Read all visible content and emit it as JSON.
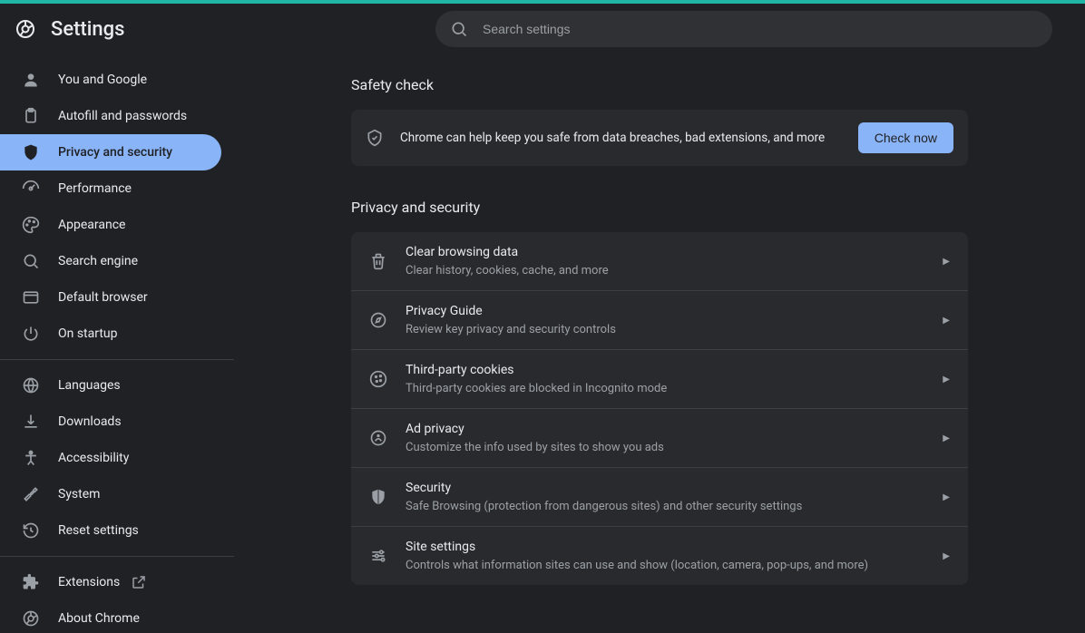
{
  "header": {
    "title": "Settings",
    "search_placeholder": "Search settings"
  },
  "sidebar": {
    "group1": [
      {
        "id": "you-google",
        "label": "You and Google",
        "icon": "person"
      },
      {
        "id": "autofill",
        "label": "Autofill and passwords",
        "icon": "clipboard"
      },
      {
        "id": "privacy",
        "label": "Privacy and security",
        "icon": "shield",
        "active": true
      },
      {
        "id": "performance",
        "label": "Performance",
        "icon": "speed"
      },
      {
        "id": "appearance",
        "label": "Appearance",
        "icon": "palette"
      },
      {
        "id": "search-engine",
        "label": "Search engine",
        "icon": "search"
      },
      {
        "id": "default-browser",
        "label": "Default browser",
        "icon": "browser"
      },
      {
        "id": "startup",
        "label": "On startup",
        "icon": "power"
      }
    ],
    "group2": [
      {
        "id": "languages",
        "label": "Languages",
        "icon": "globe"
      },
      {
        "id": "downloads",
        "label": "Downloads",
        "icon": "download"
      },
      {
        "id": "accessibility",
        "label": "Accessibility",
        "icon": "accessibility"
      },
      {
        "id": "system",
        "label": "System",
        "icon": "wrench"
      },
      {
        "id": "reset",
        "label": "Reset settings",
        "icon": "history"
      }
    ],
    "group3": [
      {
        "id": "extensions",
        "label": "Extensions",
        "icon": "extension",
        "external": true
      },
      {
        "id": "about",
        "label": "About Chrome",
        "icon": "chrome"
      }
    ]
  },
  "safety": {
    "heading": "Safety check",
    "text": "Chrome can help keep you safe from data breaches, bad extensions, and more",
    "button": "Check now"
  },
  "privacy": {
    "heading": "Privacy and security",
    "rows": [
      {
        "icon": "trash",
        "title": "Clear browsing data",
        "sub": "Clear history, cookies, cache, and more"
      },
      {
        "icon": "compass",
        "title": "Privacy Guide",
        "sub": "Review key privacy and security controls"
      },
      {
        "icon": "cookie",
        "title": "Third-party cookies",
        "sub": "Third-party cookies are blocked in Incognito mode"
      },
      {
        "icon": "ad",
        "title": "Ad privacy",
        "sub": "Customize the info used by sites to show you ads"
      },
      {
        "icon": "shield",
        "title": "Security",
        "sub": "Safe Browsing (protection from dangerous sites) and other security settings"
      },
      {
        "icon": "sliders",
        "title": "Site settings",
        "sub": "Controls what information sites can use and show (location, camera, pop-ups, and more)"
      }
    ]
  }
}
